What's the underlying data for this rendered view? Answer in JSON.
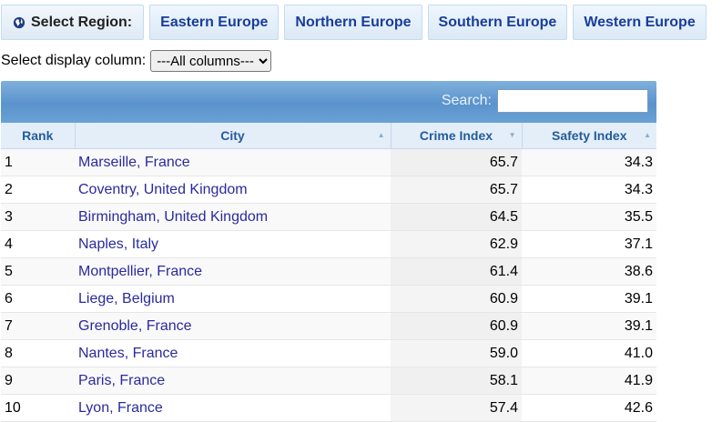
{
  "regions": {
    "select_label": "Select Region:",
    "buttons": [
      "Eastern Europe",
      "Northern Europe",
      "Southern Europe",
      "Western Europe"
    ]
  },
  "column_select": {
    "label": "Select display column:",
    "selected": "---All columns---"
  },
  "table": {
    "search_label": "Search:",
    "search_value": "",
    "headers": [
      "Rank",
      "City",
      "Crime Index",
      "Safety Index"
    ],
    "rows": [
      {
        "rank": "1",
        "city": "Marseille, France",
        "crime": "65.7",
        "safety": "34.3"
      },
      {
        "rank": "2",
        "city": "Coventry, United Kingdom",
        "crime": "65.7",
        "safety": "34.3"
      },
      {
        "rank": "3",
        "city": "Birmingham, United Kingdom",
        "crime": "64.5",
        "safety": "35.5"
      },
      {
        "rank": "4",
        "city": "Naples, Italy",
        "crime": "62.9",
        "safety": "37.1"
      },
      {
        "rank": "5",
        "city": "Montpellier, France",
        "crime": "61.4",
        "safety": "38.6"
      },
      {
        "rank": "6",
        "city": "Liege, Belgium",
        "crime": "60.9",
        "safety": "39.1"
      },
      {
        "rank": "7",
        "city": "Grenoble, France",
        "crime": "60.9",
        "safety": "39.1"
      },
      {
        "rank": "8",
        "city": "Nantes, France",
        "crime": "59.0",
        "safety": "41.0"
      },
      {
        "rank": "9",
        "city": "Paris, France",
        "crime": "58.1",
        "safety": "41.9"
      },
      {
        "rank": "10",
        "city": "Lyon, France",
        "crime": "57.4",
        "safety": "42.6"
      }
    ]
  },
  "colors": {
    "link": "#2a2a9e",
    "header_text": "#255c9a",
    "table_top": "#5a93cc"
  }
}
